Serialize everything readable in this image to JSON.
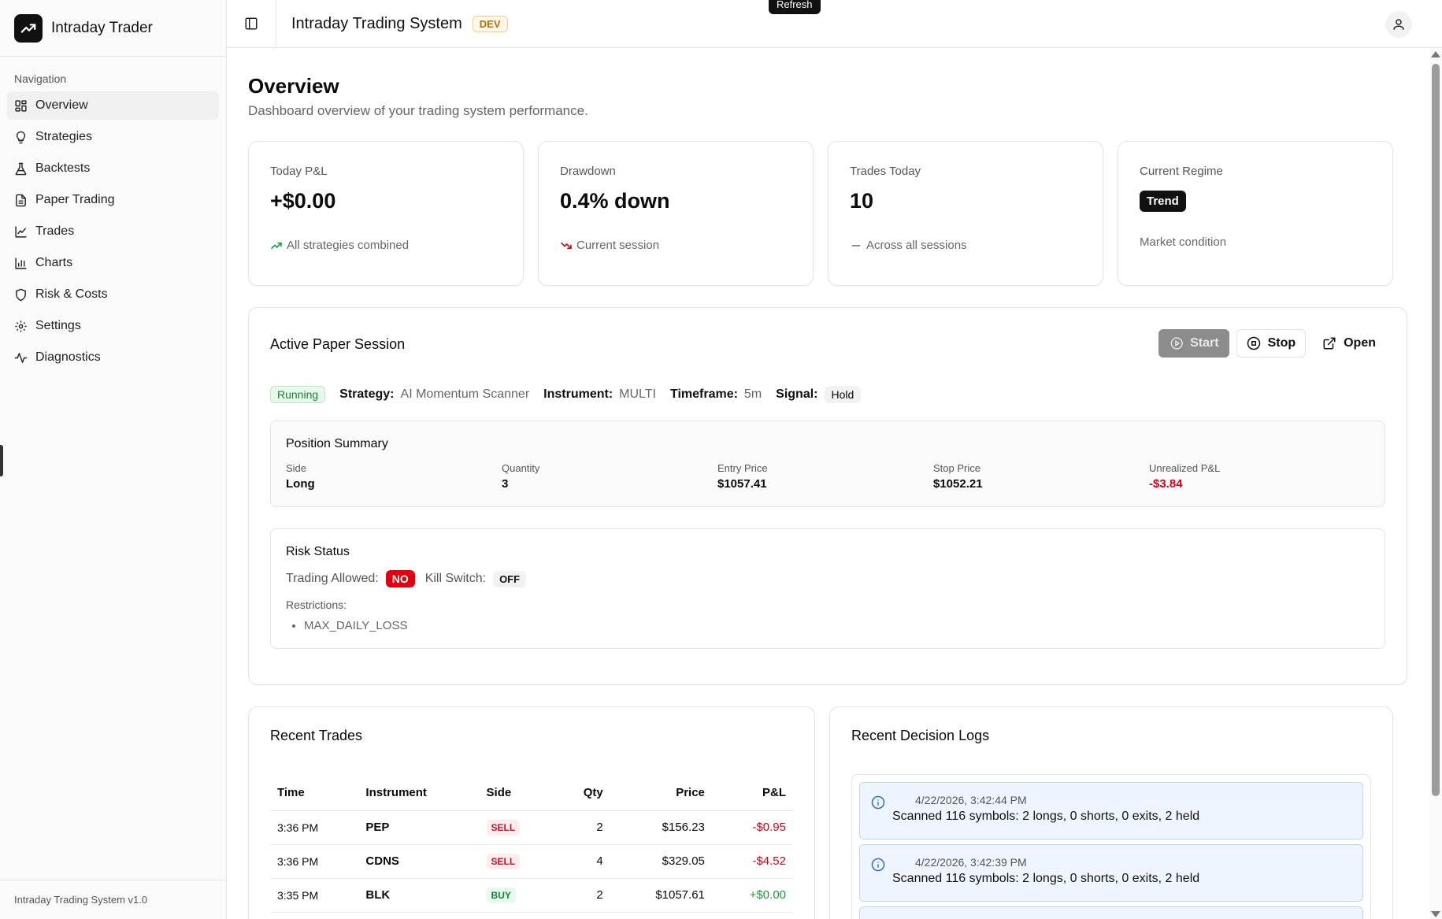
{
  "brand": {
    "name": "Intraday Trader"
  },
  "sidebar": {
    "section_label": "Navigation",
    "items": [
      {
        "label": "Overview",
        "icon": "grid-icon",
        "active": true
      },
      {
        "label": "Strategies",
        "icon": "lightbulb-icon"
      },
      {
        "label": "Backtests",
        "icon": "flask-icon"
      },
      {
        "label": "Paper Trading",
        "icon": "document-icon"
      },
      {
        "label": "Trades",
        "icon": "line-chart-icon"
      },
      {
        "label": "Charts",
        "icon": "bar-chart-icon"
      },
      {
        "label": "Risk & Costs",
        "icon": "shield-icon"
      },
      {
        "label": "Settings",
        "icon": "gear-icon"
      },
      {
        "label": "Diagnostics",
        "icon": "activity-icon"
      }
    ],
    "footer": "Intraday Trading System v1.0"
  },
  "header": {
    "title": "Intraday Trading System",
    "env_badge": "DEV",
    "tooltip": "Refresh"
  },
  "page": {
    "title": "Overview",
    "subtitle": "Dashboard overview of your trading system performance."
  },
  "stats": [
    {
      "label": "Today P&L",
      "value": "+$0.00",
      "foot": "All strategies combined"
    },
    {
      "label": "Drawdown",
      "value": "0.4% down",
      "foot": "Current session"
    },
    {
      "label": "Trades Today",
      "value": "10",
      "foot": "Across all sessions"
    },
    {
      "label": "Current Regime",
      "badge": "Trend",
      "foot": "Market condition"
    }
  ],
  "session": {
    "title": "Active Paper Session",
    "buttons": {
      "start": "Start",
      "stop": "Stop",
      "open": "Open"
    },
    "status": "Running",
    "strategy_label": "Strategy:",
    "strategy": "AI Momentum Scanner",
    "instrument_label": "Instrument:",
    "instrument": "MULTI",
    "timeframe_label": "Timeframe:",
    "timeframe": "5m",
    "signal_label": "Signal:",
    "signal": "Hold",
    "position": {
      "title": "Position Summary",
      "side_label": "Side",
      "side": "Long",
      "qty_label": "Quantity",
      "qty": "3",
      "entry_label": "Entry Price",
      "entry": "$1057.41",
      "stop_label": "Stop Price",
      "stop": "$1052.21",
      "upnl_label": "Unrealized P&L",
      "upnl": "-$3.84"
    },
    "risk": {
      "title": "Risk Status",
      "trading_allowed_label": "Trading Allowed:",
      "trading_allowed": "NO",
      "kill_switch_label": "Kill Switch:",
      "kill_switch": "OFF",
      "restrictions_label": "Restrictions:",
      "restrictions": [
        "MAX_DAILY_LOSS"
      ]
    }
  },
  "trades": {
    "title": "Recent Trades",
    "columns": [
      "Time",
      "Instrument",
      "Side",
      "Qty",
      "Price",
      "P&L"
    ],
    "rows": [
      {
        "time": "3:36 PM",
        "instrument": "PEP",
        "side": "SELL",
        "qty": "2",
        "price": "$156.23",
        "pnl": "-$0.95"
      },
      {
        "time": "3:36 PM",
        "instrument": "CDNS",
        "side": "SELL",
        "qty": "4",
        "price": "$329.05",
        "pnl": "-$4.52"
      },
      {
        "time": "3:35 PM",
        "instrument": "BLK",
        "side": "BUY",
        "qty": "2",
        "price": "$1057.61",
        "pnl": "+$0.00"
      }
    ]
  },
  "logs": {
    "title": "Recent Decision Logs",
    "items": [
      {
        "time": "4/22/2026, 3:42:44 PM",
        "message": "Scanned 116 symbols: 2 longs, 0 shorts, 0 exits, 2 held"
      },
      {
        "time": "4/22/2026, 3:42:39 PM",
        "message": "Scanned 116 symbols: 2 longs, 0 shorts, 0 exits, 2 held"
      }
    ]
  },
  "colors": {
    "negative": "#d0021b",
    "positive": "#1a9a3d",
    "dev_badge": "#c26a00",
    "info": "#2a6fd6"
  }
}
